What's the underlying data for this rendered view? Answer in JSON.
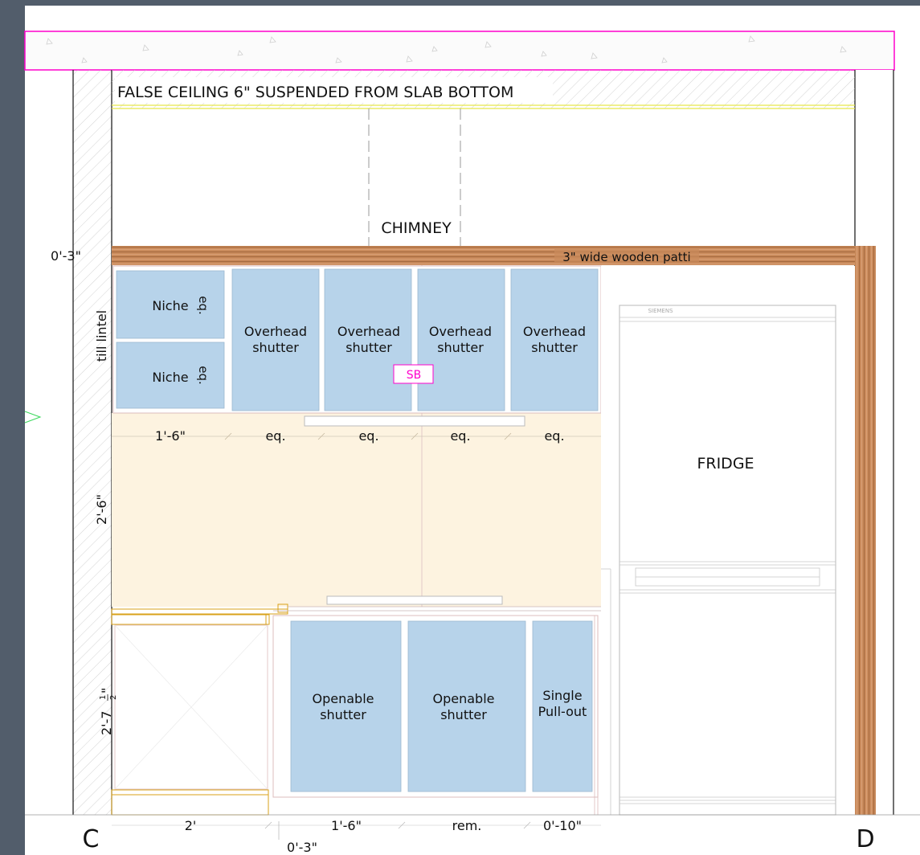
{
  "labels": {
    "false_ceiling": "FALSE CEILING 6\" SUSPENDED FROM SLAB BOTTOM",
    "chimney": "CHIMNEY",
    "patti": "3\" wide wooden patti",
    "fridge": "FRIDGE",
    "fridge_brand": "SIEMENS",
    "switchboard": "SB"
  },
  "upper_cabinets": {
    "niche_top": "Niche",
    "niche_bottom": "Niche",
    "eq_mark": "eq.",
    "overhead": [
      "Overhead\nshutter",
      "Overhead\nshutter",
      "Overhead\nshutter",
      "Overhead\nshutter"
    ]
  },
  "lower_cabinets": [
    "Openable\nshutter",
    "Openable\nshutter",
    "Single\nPull-out"
  ],
  "dimensions": {
    "top_offset": "0'-3\"",
    "till_lintel": "till lintel",
    "backsplash_height": "2'-6\"",
    "counter_height": "2'-7",
    "counter_height_frac_num": "1",
    "counter_height_frac_den": "2",
    "counter_height_inch": "\"",
    "upper_widths": [
      "1'-6\"",
      "eq.",
      "eq.",
      "eq.",
      "eq."
    ],
    "lower_widths": [
      "2'",
      "1'-6\"",
      "rem.",
      "0'-10\""
    ],
    "bottom_offset": "0'-3\""
  },
  "grid_markers": {
    "left": "C",
    "right": "D"
  },
  "colors": {
    "background": "#525d6b",
    "sheet": "#ffffff",
    "slab_outline": "#ff00cc",
    "cabinet_fill": "#b7d3ea",
    "backsplash_fill": "#fdf3e0",
    "wood_patti": "#c8895b",
    "counter_outline": "#d9a21a"
  }
}
